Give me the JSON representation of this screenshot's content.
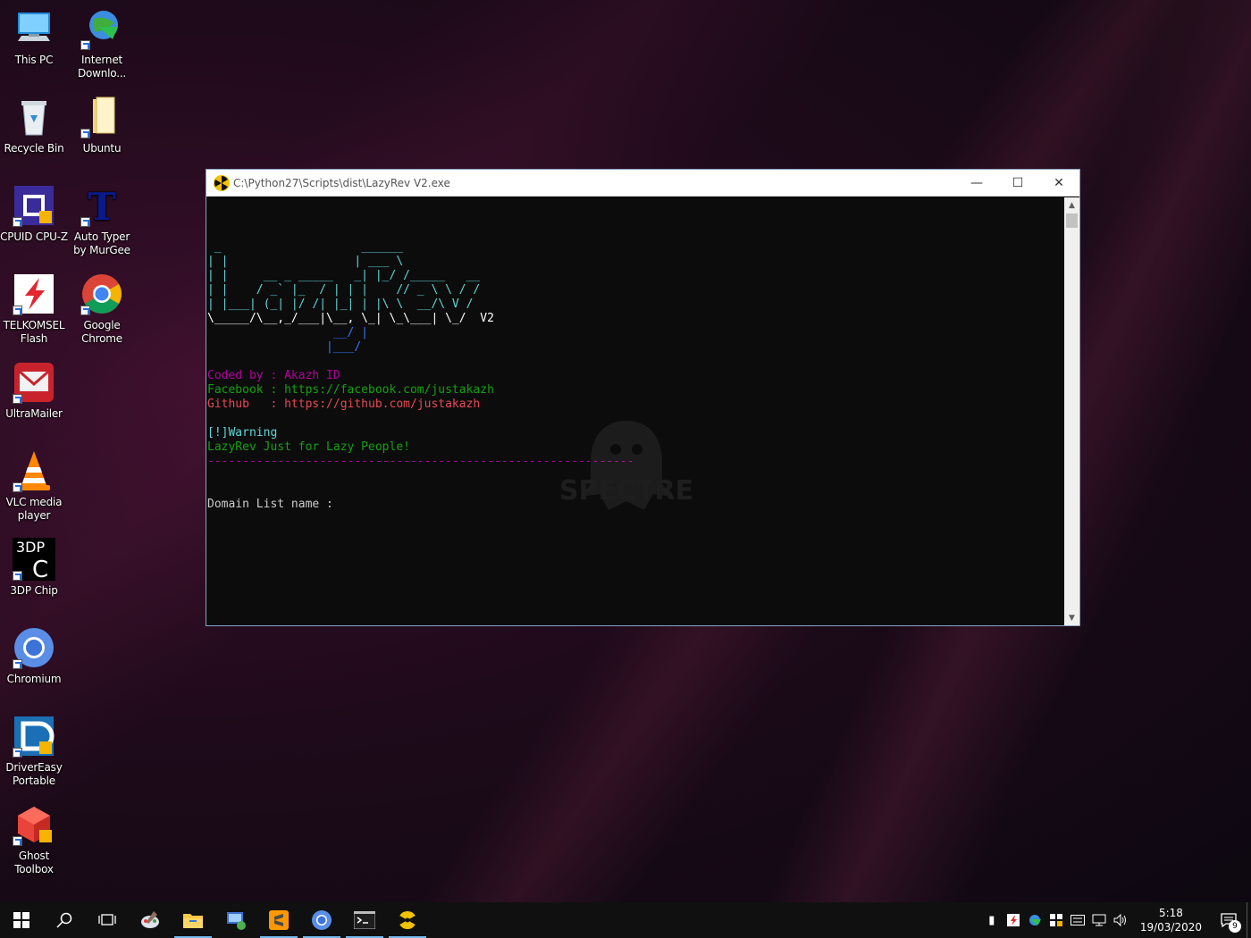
{
  "desktop": {
    "icons": [
      {
        "label": "This PC",
        "icon": "this-pc-icon"
      },
      {
        "label": "Internet Downlo...",
        "icon": "internet-download-manager-icon"
      },
      {
        "label": "Recycle Bin",
        "icon": "recycle-bin-icon"
      },
      {
        "label": "Ubuntu",
        "icon": "ubuntu-folder-icon"
      },
      {
        "label": "CPUID CPU-Z",
        "icon": "cpuz-icon"
      },
      {
        "label": "Auto Typer by MurGee",
        "icon": "auto-typer-icon"
      },
      {
        "label": "TELKOMSEL Flash",
        "icon": "telkomsel-flash-icon"
      },
      {
        "label": "Google Chrome",
        "icon": "chrome-icon"
      },
      {
        "label": "UltraMailer",
        "icon": "ultramailer-icon"
      },
      {
        "label": "VLC media player",
        "icon": "vlc-icon"
      },
      {
        "label": "3DP Chip",
        "icon": "3dp-chip-icon"
      },
      {
        "label": "Chromium",
        "icon": "chromium-icon"
      },
      {
        "label": "DriverEasy Portable",
        "icon": "drivereasy-icon"
      },
      {
        "label": "Ghost Toolbox",
        "icon": "ghost-toolbox-icon"
      }
    ]
  },
  "window": {
    "title": "C:\\Python27\\Scripts\\dist\\LazyRev V2.exe",
    "controls": {
      "minimize": "—",
      "maximize": "☐",
      "close": "✕"
    }
  },
  "console": {
    "banner_lines": [
      " _                    ______",
      "| |                  | ___ \\",
      "| |     __ _ _____   _| |_/ /_____   __",
      "| |    / _` |_  / | | |    // _ \\ \\ / /",
      "| |___| (_| |/ /| |_| | |\\ \\  __/\\ V /",
      "\\_____/\\__,_/___|\\__, \\_| \\_\\___| \\_/ ",
      "                  __/ |",
      "                 |___/"
    ],
    "version": "V2",
    "coded_by": "Coded by : Akazh ID",
    "facebook_label": "Facebook : ",
    "facebook_url": "https://facebook.com/justakazh",
    "github_label": "Github   : ",
    "github_url": "https://github.com/justakazh",
    "warning": "[!]Warning",
    "tagline": "LazyRev Just for Lazy People!",
    "separator": "-------------------------------------------------------------",
    "prompt": "Domain List name :"
  },
  "watermark": {
    "text": "SPECTRE"
  },
  "taskbar": {
    "items": [
      {
        "icon": "start-icon"
      },
      {
        "icon": "search-icon"
      },
      {
        "icon": "task-view-icon"
      },
      {
        "icon": "paint-icon"
      },
      {
        "icon": "file-explorer-icon",
        "active": true
      },
      {
        "icon": "network-tool-icon"
      },
      {
        "icon": "sublime-text-icon",
        "active": true
      },
      {
        "icon": "chromium-icon",
        "active": true
      },
      {
        "icon": "cmd-icon",
        "active": true
      },
      {
        "icon": "lazyrev-icon",
        "active": true
      }
    ],
    "clock_time": "5:18",
    "clock_date": "19/03/2020",
    "notification_count": "9"
  },
  "colors": {
    "banner": "#61d6d6",
    "banner_blue": "#3b78ff",
    "coded_by": "#b4009e",
    "facebook": "#13a10e",
    "github": "#e74856",
    "warning": "#61d6d6",
    "tagline": "#13a10e",
    "separator": "#b4009e",
    "prompt": "#cccccc"
  }
}
